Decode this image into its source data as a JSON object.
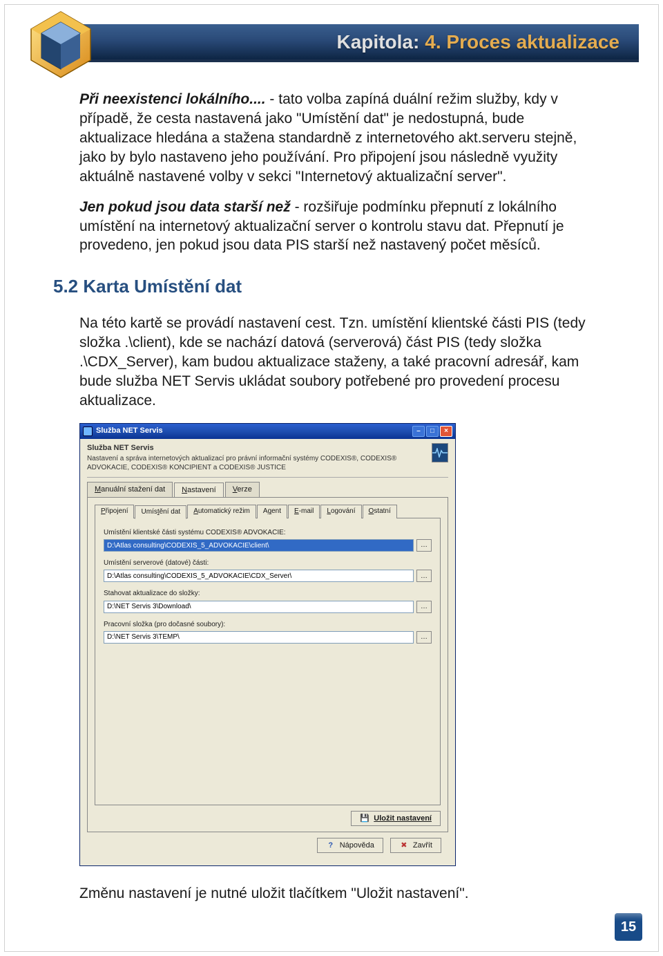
{
  "chapter": {
    "label": "Kapitola:",
    "title": "4. Proces aktualizace"
  },
  "para1_lead": "Při neexistenci lokálního....",
  "para1_body": " - tato volba zapíná duální režim služby, kdy v případě, že cesta nastavená jako \"Umístění dat\" je nedostupná, bude aktualizace hledána a stažena standardně z internetového akt.serveru stejně, jako by bylo nastaveno jeho používání. Pro připojení jsou následně využity aktuálně nastavené volby v sekci \"Internetový aktualizační server\".",
  "para2_lead": "Jen pokud jsou data starší než",
  "para2_body": " - rozšiřuje podmínku přepnutí z lokálního umístění na internetový aktualizační server o kontrolu stavu dat. Přepnutí je provedeno, jen pokud jsou data PIS starší než nastavený počet měsíců.",
  "section_heading": "5.2 Karta Umístění dat",
  "para3": "Na této kartě se provádí nastavení cest. Tzn. umístění klientské části PIS (tedy složka .\\client), kde se nachází datová (serverová) část PIS (tedy složka .\\CDX_Server), kam budou aktualizace staženy, a také pracovní adresář, kam bude služba NET Servis ukládat soubory potřebené pro provedení procesu aktualizace.",
  "screenshot": {
    "title": "Služba NET Servis",
    "header_title": "Služba NET Servis",
    "header_sub": "Nastavení a správa internetových aktualizací pro právní informační systémy CODEXIS®, CODEXIS® ADVOKACIE, CODEXIS® KONCIPIENT a CODEXIS® JUSTICE",
    "main_tabs": [
      "Manuální stažení dat",
      "Nastavení",
      "Verze"
    ],
    "active_main_tab": 1,
    "sub_tabs": [
      "Připojení",
      "Umístění dat",
      "Automatický režim",
      "Agent",
      "E-mail",
      "Logování",
      "Ostatní"
    ],
    "active_sub_tab": 1,
    "fields": [
      {
        "label": "Umístění klientské části systému CODEXIS® ADVOKACIE:",
        "value": "D:\\Atlas consulting\\CODEXIS_5_ADVOKACIE\\client\\",
        "selected": true
      },
      {
        "label": "Umístění serverové (datové) části:",
        "value": "D:\\Atlas consulting\\CODEXIS_5_ADVOKACIE\\CDX_Server\\",
        "selected": false
      },
      {
        "label": "Stahovat aktualizace do složky:",
        "value": "D:\\NET Servis 3\\Download\\",
        "selected": false
      },
      {
        "label": "Pracovní složka (pro dočasné soubory):",
        "value": "D:\\NET Servis 3\\TEMP\\",
        "selected": false
      }
    ],
    "save_btn": "Uložit nastavení",
    "help_btn": "Nápověda",
    "close_btn": "Zavřít"
  },
  "footer_para": "Změnu nastavení je nutné uložit tlačítkem \"Uložit nastavení\".",
  "page_number": "15"
}
